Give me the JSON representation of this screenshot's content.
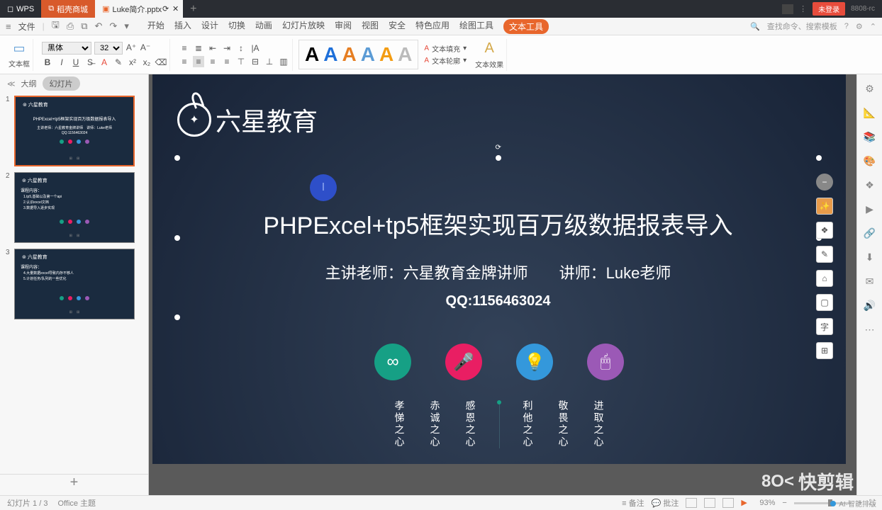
{
  "titlebar": {
    "wps": "WPS",
    "tab1": "稻壳商城",
    "tab2": "Luke简介.pptx",
    "login": "未登录",
    "code": "8808-rc"
  },
  "menubar": {
    "file": "文件",
    "tabs": [
      "开始",
      "插入",
      "设计",
      "切换",
      "动画",
      "幻灯片放映",
      "审阅",
      "视图",
      "安全",
      "特色应用",
      "绘图工具",
      "文本工具"
    ],
    "search": "查找命令、搜索模板"
  },
  "toolbar": {
    "textbox": "文本框",
    "font": "黑体",
    "size": "32",
    "fill": "文本填充",
    "outline": "文本轮廓",
    "effect": "文本效果"
  },
  "slidepanel": {
    "outline": "大纲",
    "slides": "幻灯片",
    "logoText": "六星教育",
    "s1title": "PHPExcel+tp5框架实现百万级数据报表导入",
    "s1sub": "主讲老师：六星教育金牌讲师　讲师：Luke老师",
    "s1qq": "QQ:1156463024",
    "s2title": "课程内容：",
    "s2l1": "1.tp5,基础以及第一个api",
    "s2l2": "2.认识excel文档",
    "s2l3": "3.数据导入逐步实现",
    "s3title": "课程内容：",
    "s3l1": "4.大量数据excel导致内存不够人",
    "s3l2": "5.计划任务/队列的一些优化"
  },
  "slide": {
    "logo": "六星教育",
    "title": "PHPExcel+tp5框架实现百万级数据报表导入",
    "subtitle": "主讲老师：六星教育金牌讲师　　讲师：Luke老师",
    "qq": "QQ:1156463024",
    "motto_left": [
      "孝悌之心",
      "赤诚之心",
      "感恩之心"
    ],
    "motto_right": [
      "利他之心",
      "敬畏之心",
      "进取之心"
    ]
  },
  "statusbar": {
    "slide": "幻灯片 1 / 3",
    "theme": "Office 主题",
    "notes": "备注",
    "comments": "批注",
    "zoom": "93%",
    "ai": "AI·智能排版"
  },
  "watermark": "快剪辑"
}
